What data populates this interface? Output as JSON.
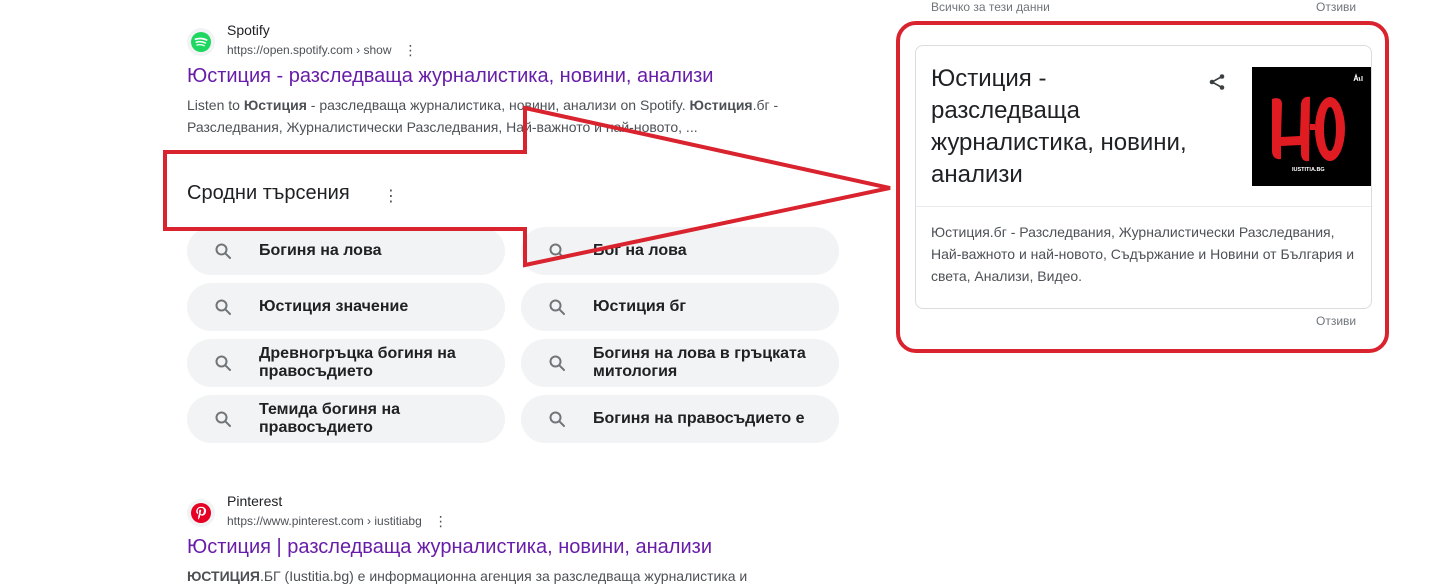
{
  "results": [
    {
      "site_name": "Spotify",
      "url": "https://open.spotify.com › show",
      "title": "Юстиция - разследваща журналистика, новини, анализи",
      "snippet_html": "Listen to <b>Юстиция</b> - разследваща журналистика, новини, анализи on Spotify. <b>Юстиция</b>.бг - Разследвания, Журналистически Разследвания, Най-важното и най-новото, ...",
      "favicon": "spotify-logo",
      "favicon_color": "#1ed760"
    },
    {
      "site_name": "Pinterest",
      "url": "https://www.pinterest.com › iustitiabg",
      "title": "Юстиция | разследваща журналистика, новини, анализи",
      "snippet_html": "<b>ЮСТИЦИЯ</b>.БГ (Iustitia.bg) е информационна агенция за разследваща журналистика и",
      "favicon": "pinterest-logo",
      "favicon_color": "#e60023"
    }
  ],
  "related": {
    "heading": "Сродни търсения",
    "items": [
      "Богиня на лова",
      "Бог на лова",
      "Юстиция значение",
      "Юстиция бг",
      "Древногръцка богиня на правосъдието",
      "Богиня на лова в гръцката митология",
      "Темида богиня на правосъдието",
      "Богиня на правосъдието е"
    ]
  },
  "knowledge_panel": {
    "about_label": "Всичко за тези данни",
    "feedback_label_top": "Отзиви",
    "title": "Юстиция - разследваща журналистика, новини, анализи",
    "logo_text": "IUSTITIA.BG",
    "description": "Юстиция.бг - Разследвания, Журналистически Разследвания, Най-важното и най-новото, Съдържание и Новини от България и света, Анализи, Видео.",
    "feedback_label_bottom": "Отзиви"
  },
  "colors": {
    "link_visited": "#681da8",
    "annotation_red": "#d9232e",
    "chip_bg": "#f1f3f4"
  }
}
